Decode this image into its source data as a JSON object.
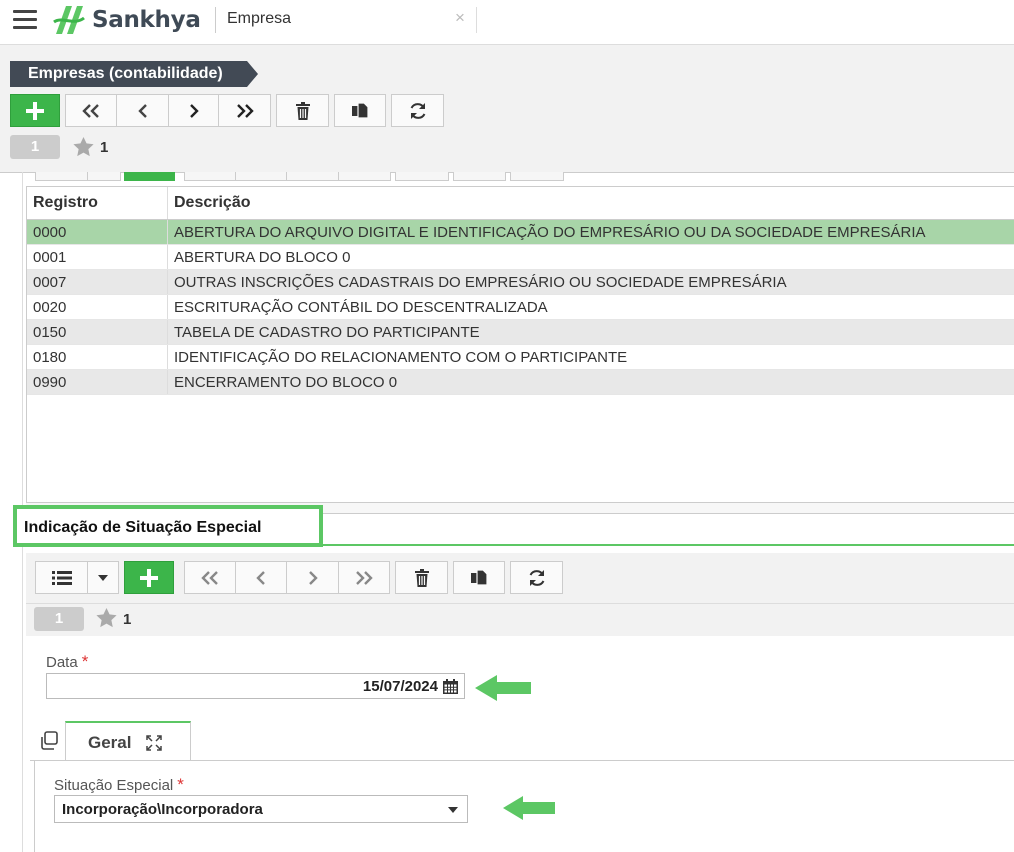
{
  "app": {
    "brand": "Sankhya",
    "tab_title": "Empresa",
    "close_glyph": "×"
  },
  "header": {
    "breadcrumb": "Empresas (contabilidade)",
    "page_number": "1",
    "favorites_count": "1"
  },
  "grid": {
    "columns": [
      "Registro",
      "Descrição"
    ],
    "rows": [
      {
        "registro": "0000",
        "descricao": "ABERTURA DO ARQUIVO DIGITAL E IDENTIFICAÇÃO DO EMPRESÁRIO OU DA SOCIEDADE EMPRESÁRIA"
      },
      {
        "registro": "0001",
        "descricao": "ABERTURA DO BLOCO 0"
      },
      {
        "registro": "0007",
        "descricao": "OUTRAS INSCRIÇÕES CADASTRAIS DO EMPRESÁRIO OU SOCIEDADE EMPRESÁRIA"
      },
      {
        "registro": "0020",
        "descricao": "ESCRITURAÇÃO CONTÁBIL DO DESCENTRALIZADA"
      },
      {
        "registro": "0150",
        "descricao": "TABELA DE CADASTRO DO PARTICIPANTE"
      },
      {
        "registro": "0180",
        "descricao": "IDENTIFICAÇÃO DO RELACIONAMENTO COM O PARTICIPANTE"
      },
      {
        "registro": "0990",
        "descricao": "ENCERRAMENTO DO BLOCO 0"
      }
    ]
  },
  "detail": {
    "section_title": "Indicação de Situação Especial",
    "page_number": "1",
    "favorites_count": "1",
    "data_label": "Data",
    "data_value": "15/07/2024",
    "required_mark": "*",
    "tab_geral": "Geral",
    "situacao_label": "Situação Especial",
    "situacao_value": "Incorporação\\Incorporadora"
  },
  "colors": {
    "accent": "#3cb54a",
    "highlight_border": "#5cc764",
    "selected_row": "#a8d5a8",
    "breadcrumb_bg": "#424a55"
  }
}
